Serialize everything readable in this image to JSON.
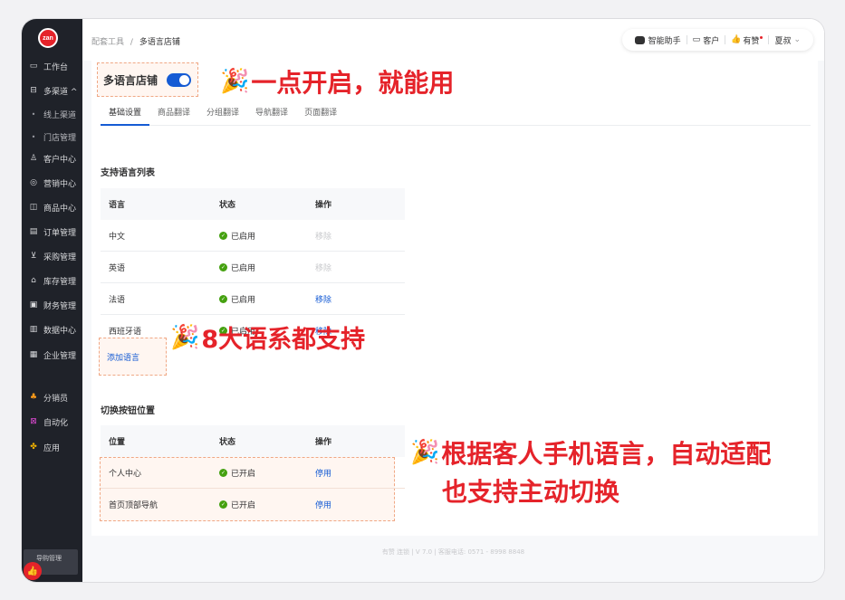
{
  "sidebar": {
    "logo_text": "zan",
    "items": [
      {
        "icon": "workbench-icon",
        "glyph": "▭",
        "label": "工作台"
      },
      {
        "icon": "channel-icon",
        "glyph": "⊟",
        "label": "多渠道 ^"
      },
      {
        "icon": "bullet-icon",
        "glyph": "•",
        "label": "线上渠道"
      },
      {
        "icon": "bullet-icon",
        "glyph": "•",
        "label": "门店管理"
      },
      {
        "icon": "user-icon",
        "glyph": "♙",
        "label": "客户中心"
      },
      {
        "icon": "target-icon",
        "glyph": "◎",
        "label": "营销中心"
      },
      {
        "icon": "bag-icon",
        "glyph": "◫",
        "label": "商品中心"
      },
      {
        "icon": "order-icon",
        "glyph": "▤",
        "label": "订单管理"
      },
      {
        "icon": "cart-icon",
        "glyph": "⊻",
        "label": "采购管理"
      },
      {
        "icon": "warehouse-icon",
        "glyph": "⌂",
        "label": "库存管理"
      },
      {
        "icon": "finance-icon",
        "glyph": "▣",
        "label": "财务管理"
      },
      {
        "icon": "chart-icon",
        "glyph": "▥",
        "label": "数据中心"
      },
      {
        "icon": "enterprise-icon",
        "glyph": "▦",
        "label": "企业管理"
      },
      {
        "icon": "distributor-icon",
        "glyph": "♣",
        "label": "分销员"
      },
      {
        "icon": "automation-icon",
        "glyph": "⊠",
        "label": "自动化"
      },
      {
        "icon": "apps-icon",
        "glyph": "✤",
        "label": "应用"
      }
    ],
    "bottom_label": "导购管理",
    "thumb_glyph": "👍"
  },
  "topbar": {
    "breadcrumb_parent": "配套工具",
    "breadcrumb_sep": "/",
    "breadcrumb_current": "多语言店铺",
    "assistant_label": "智能助手",
    "customer_label": "客户",
    "youzan_label": "有赞",
    "user_label": "夏叔",
    "user_caret": "⌄",
    "customer_glyph": "▭",
    "youzan_glyph": "👍"
  },
  "page": {
    "title": "多语言店铺",
    "toggle_on": true,
    "tabs": [
      "基础设置",
      "商品翻译",
      "分组翻译",
      "导航翻译",
      "页面翻译"
    ],
    "active_tab": 0,
    "languages_section_title": "支持语言列表",
    "languages_table": {
      "headers": [
        "语言",
        "状态",
        "操作"
      ],
      "rows": [
        {
          "lang": "中文",
          "status": "已启用",
          "action": "移除",
          "action_enabled": false
        },
        {
          "lang": "英语",
          "status": "已启用",
          "action": "移除",
          "action_enabled": false
        },
        {
          "lang": "法语",
          "status": "已启用",
          "action": "移除",
          "action_enabled": true
        },
        {
          "lang": "西班牙语",
          "status": "已启用",
          "action": "移除",
          "action_enabled": true
        }
      ]
    },
    "add_language_label": "添加语言",
    "switch_section_title": "切换按钮位置",
    "switch_table": {
      "headers": [
        "位置",
        "状态",
        "操作"
      ],
      "rows": [
        {
          "position": "个人中心",
          "status": "已开启",
          "action": "停用"
        },
        {
          "position": "首页顶部导航",
          "status": "已开启",
          "action": "停用"
        }
      ]
    },
    "check_glyph": "✓"
  },
  "footer": {
    "text": "有赞 连锁 | V 7.0 | 客服电话: 0571 - 8998 8848"
  },
  "promos": {
    "popper_glyph": "🎉",
    "one_click": "一点开启，就能用",
    "eight_lang": "8大语系都支持",
    "auto_line1": "根据客人手机语言，自动适配",
    "auto_line2": "也支持主动切换"
  },
  "colors": {
    "accent": "#155bd4",
    "promo_red": "#e5232a",
    "success": "#45a110",
    "sidebar_bg": "#1f2229"
  }
}
